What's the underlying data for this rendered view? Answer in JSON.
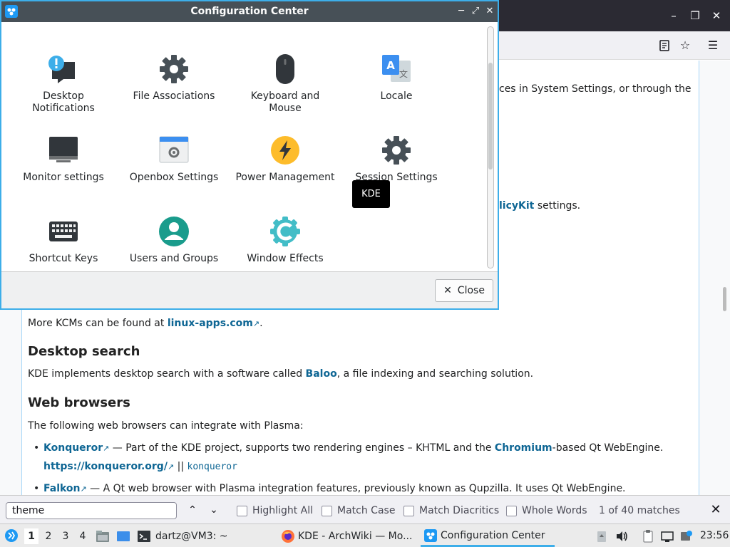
{
  "dialog": {
    "title": "Configuration Center",
    "items": [
      {
        "label": "Desktop\nNotifications",
        "icon": "notification-bubble-icon"
      },
      {
        "label": "File Associations",
        "icon": "gear-icon"
      },
      {
        "label": "Keyboard and\nMouse",
        "icon": "mouse-icon"
      },
      {
        "label": "Locale",
        "icon": "translate-icon"
      },
      {
        "label": "Monitor settings",
        "icon": "monitor-icon"
      },
      {
        "label": "Openbox Settings",
        "icon": "window-settings-icon"
      },
      {
        "label": "Power Management",
        "icon": "lightning-icon"
      },
      {
        "label": "Session Settings",
        "icon": "gear-icon"
      },
      {
        "label": "Shortcut Keys",
        "icon": "keyboard-icon"
      },
      {
        "label": "Users and Groups",
        "icon": "user-icon"
      },
      {
        "label": "Window Effects",
        "icon": "compiz-icon"
      }
    ],
    "close_label": "Close",
    "tooltip": "KDE"
  },
  "browser": {
    "partial_line_1": "ces in System Settings, or through the",
    "partial_line_2_link": "licyKit",
    "partial_line_2_text": " settings.",
    "more_kcms_text": "More KCMs can be found at ",
    "more_kcms_link": "linux-apps.com",
    "heading_desktop_search": "Desktop search",
    "baloo_text_1": "KDE implements desktop search with a software called ",
    "baloo_link": "Baloo",
    "baloo_text_2": ", a file indexing and searching solution.",
    "heading_web_browsers": "Web browsers",
    "web_browsers_intro": "The following web browsers can integrate with Plasma:",
    "konqueror_link": "Konqueror",
    "konqueror_text_1": " — Part of the KDE project, supports two rendering engines – KHTML and the ",
    "chromium_link": "Chromium",
    "konqueror_text_2": "-based Qt WebEngine.",
    "konqueror_url": "https://konqueror.org/",
    "konqueror_sep": " || ",
    "konqueror_pkg": "konqueror",
    "falkon_link": "Falkon",
    "falkon_text": " — A Qt web browser with Plasma integration features, previously known as Qupzilla. It uses Qt WebEngine."
  },
  "findbar": {
    "query": "theme",
    "highlight_all": "Highlight All",
    "match_case": "Match Case",
    "match_diacritics": "Match Diacritics",
    "whole_words": "Whole Words",
    "matches": "1 of 40 matches"
  },
  "taskbar": {
    "desktops": [
      "1",
      "2",
      "3",
      "4"
    ],
    "tasks": [
      {
        "label": "dartz@VM3: ~",
        "icon": "terminal-icon"
      },
      {
        "label": "KDE - ArchWiki — Mo...",
        "icon": "firefox-icon"
      },
      {
        "label": "Configuration Center",
        "icon": "config-center-icon"
      }
    ],
    "clock": "23:56"
  },
  "colors": {
    "accent": "#3daee9",
    "titlebar": "#475057",
    "link": "#0e6694"
  }
}
